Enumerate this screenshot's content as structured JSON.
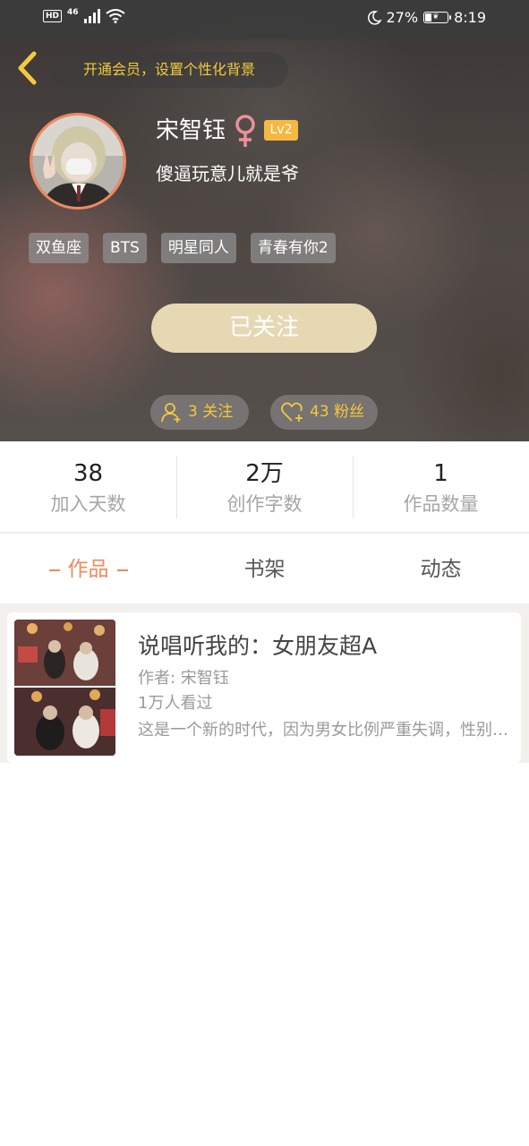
{
  "status_bar": {
    "hd": "HD",
    "network": "46",
    "battery": "27%",
    "time": "8:19"
  },
  "header": {
    "vip_banner": "开通会员，设置个性化背景",
    "user_name": "宋智钰",
    "level": "Lv2",
    "signature": "傻逼玩意儿就是爷",
    "tags": [
      "双鱼座",
      "BTS",
      "明星同人",
      "青春有你2"
    ],
    "follow_button": "已关注",
    "following": "3 关注",
    "fans": "43 粉丝"
  },
  "stats": [
    {
      "value": "38",
      "label": "加入天数"
    },
    {
      "value": "2万",
      "label": "创作字数"
    },
    {
      "value": "1",
      "label": "作品数量"
    }
  ],
  "tabs": [
    "作品",
    "书架",
    "动态"
  ],
  "works": [
    {
      "title": "说唱听我的：女朋友超A",
      "author": "作者: 宋智钰",
      "views": "1万人看过",
      "description": "这是一个新的时代，因为男女比例严重失调，性别已不再是问题，主角是一名女生，她的说唱天赋让所有人为之惊叹，而她的女朋友则是一个超A的存在"
    }
  ],
  "colors": {
    "accent": "#f0895a",
    "gold": "#f4c93c",
    "follow_button_bg": "#e5d8b3",
    "level_badge": "#f5b841"
  },
  "icons": {
    "back": "chevron-left-icon",
    "gender": "female-symbol-icon",
    "following": "person-add-icon",
    "fans": "heart-add-icon"
  }
}
